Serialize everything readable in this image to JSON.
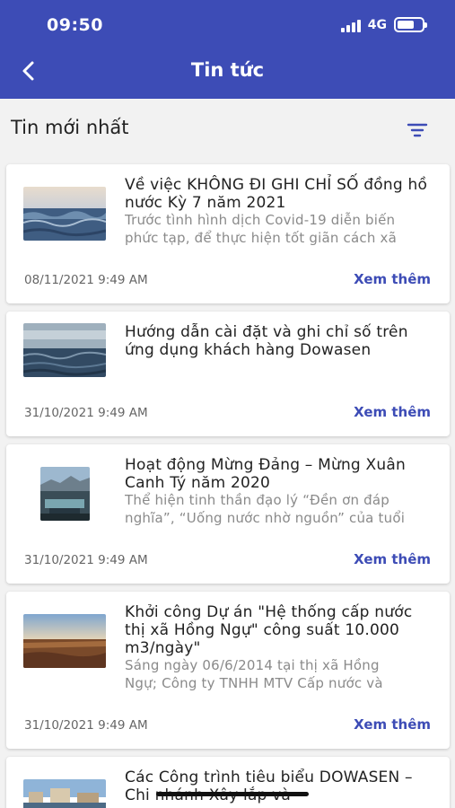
{
  "status_bar": {
    "time": "09:50",
    "network": "4G"
  },
  "header": {
    "title": "Tin tức"
  },
  "section": {
    "title": "Tin mới nhất"
  },
  "news": [
    {
      "title": "Về việc KHÔNG ĐI GHI CHỈ SỐ đồng hồ nước Kỳ 7 năm 2021",
      "summary_lines": [
        "Trước tình hình dịch Covid-19 diễn biến",
        "phức tạp, để thực hiện tốt giãn cách xã"
      ],
      "date": "08/11/2021 9:49 AM",
      "more": "Xem thêm"
    },
    {
      "title": "Hướng dẫn cài đặt và ghi chỉ số trên ứng dụng khách hàng Dowasen",
      "summary_lines": [],
      "date": "31/10/2021 9:49 AM",
      "more": "Xem thêm"
    },
    {
      "title": "Hoạt động Mừng Đảng – Mừng Xuân Canh Tý năm 2020",
      "summary_lines": [
        "Thể hiện tinh thần đạo lý “Đền ơn đáp",
        "nghĩa”, “Uống nước nhờ nguồn” của tuổi"
      ],
      "date": "31/10/2021 9:49 AM",
      "more": "Xem thêm"
    },
    {
      "title": "Khởi công Dự án \"Hệ thống cấp nước thị xã Hồng Ngự\" công suất 10.000 m3/ngày\"",
      "summary_lines": [
        "Sáng ngày 06/6/2014 tại thị xã Hồng",
        "Ngự; Công ty TNHH MTV Cấp nước và"
      ],
      "date": "31/10/2021 9:49 AM",
      "more": "Xem thêm"
    },
    {
      "title": "Các Công trình tiêu biểu DOWASEN – Chi nhánh Xây lắp và",
      "summary_lines": [],
      "date": "",
      "more": ""
    }
  ]
}
